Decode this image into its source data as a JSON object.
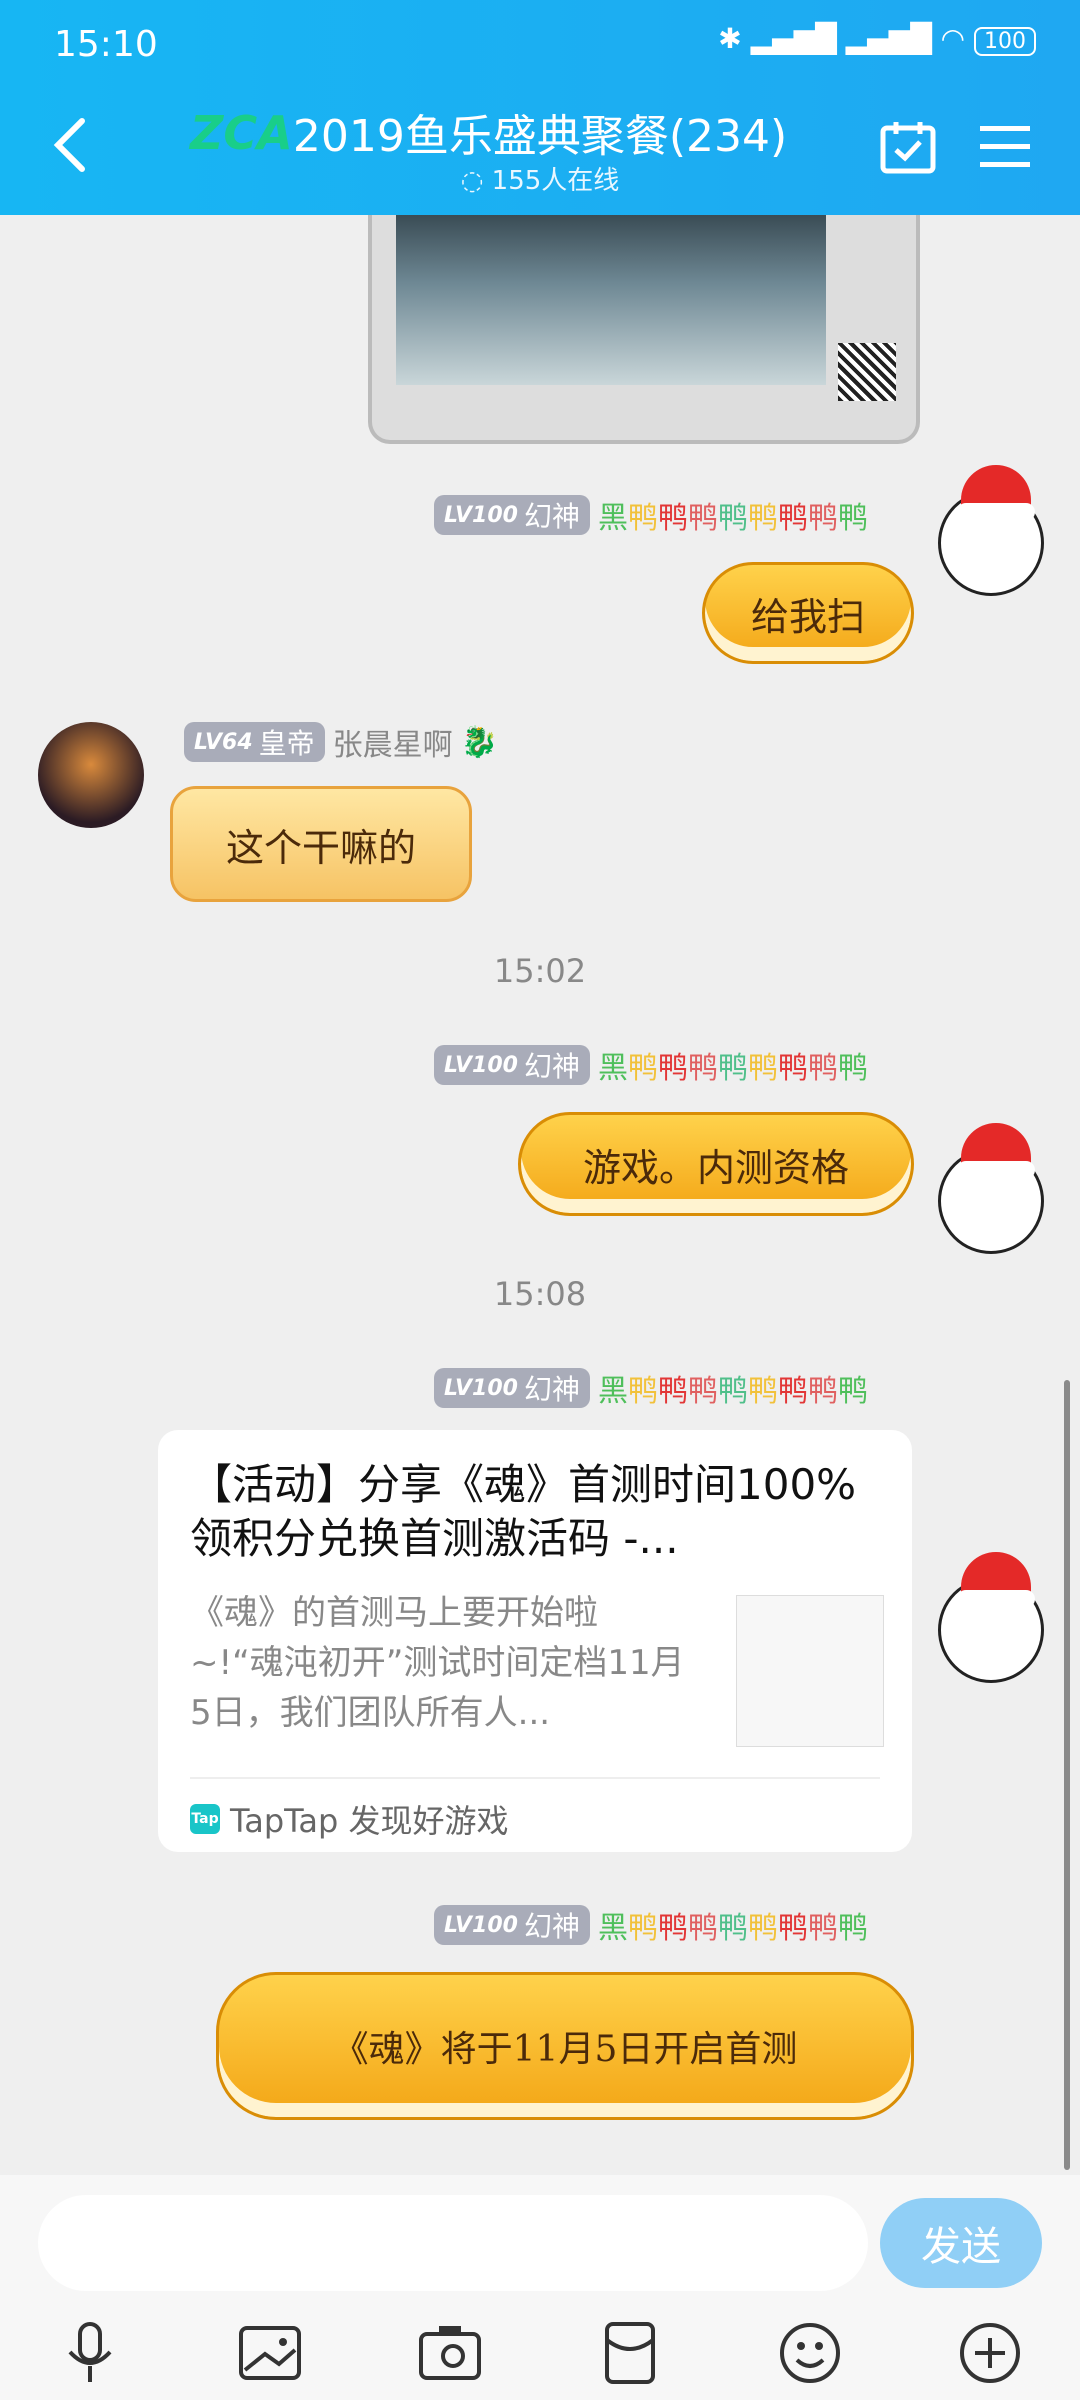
{
  "status": {
    "time": "15:10",
    "battery": "100"
  },
  "header": {
    "title": "2019鱼乐盛典聚餐(234)",
    "online": "155人在线",
    "logo_text": "ZCA"
  },
  "messages": {
    "m1": {
      "level": "LV100",
      "rank": "幻神",
      "name_chars": [
        "黑",
        "鸭",
        "鸭",
        "鸭",
        "鸭",
        "鸭",
        "鸭",
        "鸭",
        "鸭"
      ],
      "name_colors": [
        "#4fbf5b",
        "#f2c13a",
        "#e23636",
        "#e06060",
        "#4fbf8a",
        "#f2c13a",
        "#e23636",
        "#e06060",
        "#4fbf5b"
      ],
      "sticker": "给我扫"
    },
    "m2": {
      "level": "LV64",
      "rank": "皇帝",
      "name": "张晨星啊",
      "sticker": "这个干嘛的"
    },
    "ts1": "15:02",
    "m3": {
      "level": "LV100",
      "rank": "幻神",
      "sticker": "游戏。内测资格"
    },
    "ts2": "15:08",
    "m4": {
      "level": "LV100",
      "rank": "幻神",
      "card_title": "【活动】分享《魂》首测时间100%领积分兑换首测激活码 -...",
      "card_desc": "《魂》的首测马上要开始啦~!“魂沌初开”测试时间定档11月5日，我们团队所有人...",
      "card_source": "TapTap 发现好游戏",
      "tap_icon": "Tap"
    },
    "m5": {
      "level": "LV100",
      "rank": "幻神",
      "sticker": "《魂》将于11月5日开启首测"
    }
  },
  "input": {
    "send_label": "发送"
  }
}
